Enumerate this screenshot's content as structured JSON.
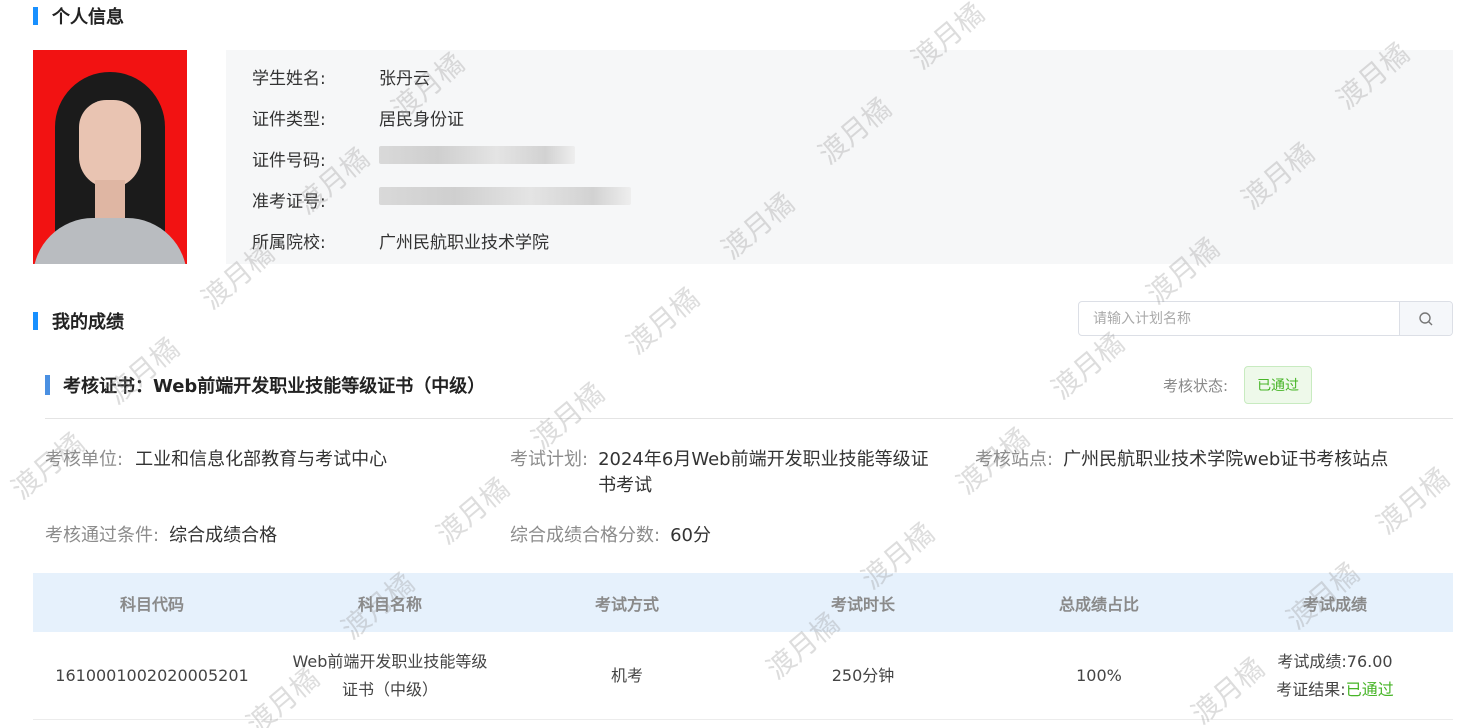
{
  "personal": {
    "section_title": "个人信息",
    "fields": [
      {
        "label": "学生姓名:",
        "value": "张丹云"
      },
      {
        "label": "证件类型:",
        "value": "居民身份证"
      },
      {
        "label": "证件号码:",
        "value": ""
      },
      {
        "label": "准考证号:",
        "value": ""
      },
      {
        "label": "所属院校:",
        "value": "广州民航职业技术学院"
      }
    ]
  },
  "scores": {
    "section_title": "我的成绩",
    "search_placeholder": "请输入计划名称",
    "cert_title": "考核证书：Web前端开发职业技能等级证书（中级）",
    "status_label": "考核状态:",
    "status_value": "已通过",
    "details": {
      "unit_label": "考核单位:",
      "unit_value": "工业和信息化部教育与考试中心",
      "plan_label": "考试计划:",
      "plan_value_line1": "2024年6月Web前端开发职业技能等级证",
      "plan_value_line2": "书考试",
      "site_label": "考核站点:",
      "site_value": "广州民航职业技术学院web证书考核站点",
      "cond_label": "考核通过条件:",
      "cond_value": "综合成绩合格",
      "pass_score_label": "综合成绩合格分数:",
      "pass_score_value": "60分"
    },
    "table": {
      "headers": [
        "科目代码",
        "科目名称",
        "考试方式",
        "考试时长",
        "总成绩占比",
        "考试成绩"
      ],
      "rows": [
        {
          "code": "1610001002020005201",
          "name_line1": "Web前端开发职业技能等级",
          "name_line2": "证书（中级）",
          "method": "机考",
          "duration": "250分钟",
          "ratio": "100%",
          "score_label": "考试成绩:",
          "score_value": "76.00",
          "result_label": "考证结果:",
          "result_value": "已通过"
        }
      ]
    }
  },
  "watermark_text": "渡月橘",
  "colors": {
    "accent": "#1890ff",
    "pass": "#48b528",
    "table_header_bg": "#e6f1fc"
  }
}
